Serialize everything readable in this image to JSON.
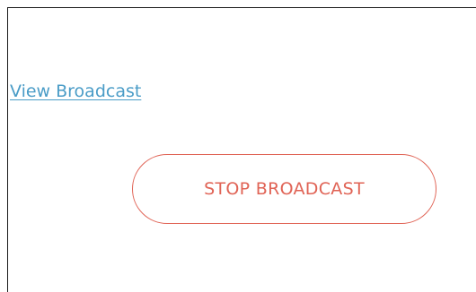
{
  "broadcast": {
    "view_link_label": "View Broadcast",
    "stop_button_label": "STOP BROADCAST"
  },
  "colors": {
    "link": "#4a9cc7",
    "stop_accent": "#e06355",
    "frame_border": "#1a1a1a",
    "background": "#ffffff"
  }
}
